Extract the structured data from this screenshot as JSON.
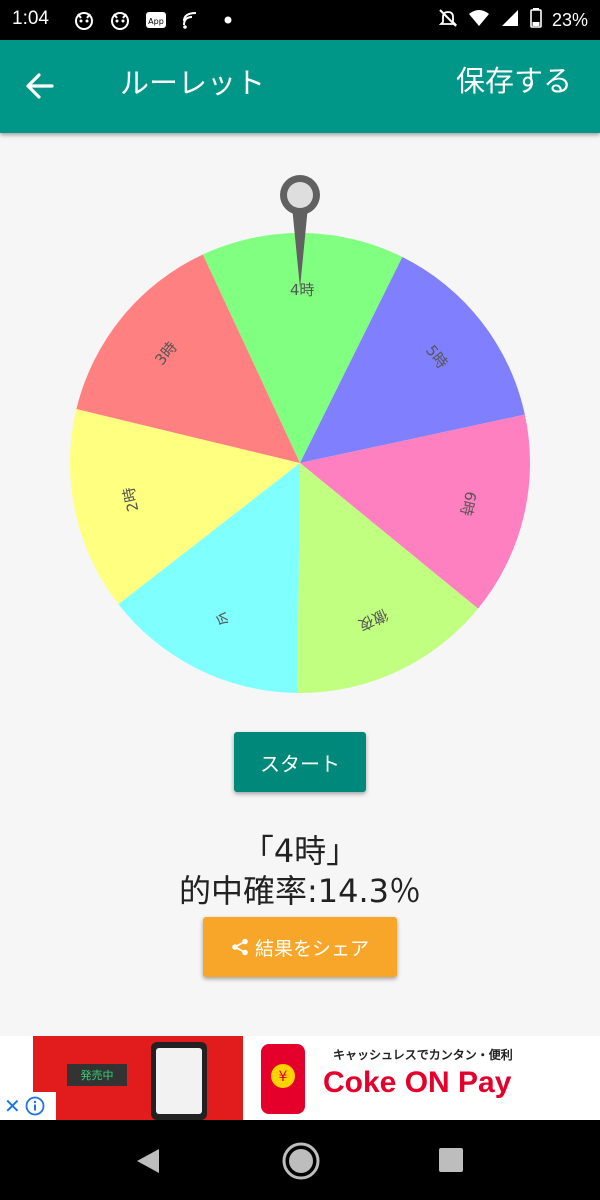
{
  "status_bar": {
    "time": "1:04",
    "battery": "23%",
    "left_icons": [
      "game-icon",
      "game-icon",
      "app-badge-icon",
      "cast-icon",
      "dot-icon"
    ],
    "app_badge_text": "App",
    "right_icons": [
      "mute-icon",
      "wifi-icon",
      "signal-icon",
      "battery-icon"
    ]
  },
  "app_bar": {
    "title": "ルーレット",
    "save_label": "保存する",
    "background": "#009688"
  },
  "roulette": {
    "segments": [
      {
        "label": "4時",
        "color": "#80ff80"
      },
      {
        "label": "5時",
        "color": "#8080ff"
      },
      {
        "label": "6時",
        "color": "#ff80c0"
      },
      {
        "label": "徹夜",
        "color": "#c0ff80"
      },
      {
        "label": "今",
        "color": "#80ffff"
      },
      {
        "label": "2時",
        "color": "#ffff80"
      },
      {
        "label": "3時",
        "color": "#ff8080"
      }
    ],
    "selected_index": 0,
    "pointer_color": "#616161"
  },
  "controls": {
    "start_label": "スタート",
    "result_name": "「4時」",
    "result_probability": "的中確率:14.3％",
    "share_label": "結果をシェア",
    "start_color": "#00897b",
    "share_color": "#f7a62a"
  },
  "ad": {
    "tagline": "キャッシュレスでカンタン・便利",
    "brand": "Coke ON Pay",
    "sign_text": "発売中"
  },
  "nav_bar": {
    "buttons": [
      "back",
      "home",
      "recents"
    ]
  }
}
